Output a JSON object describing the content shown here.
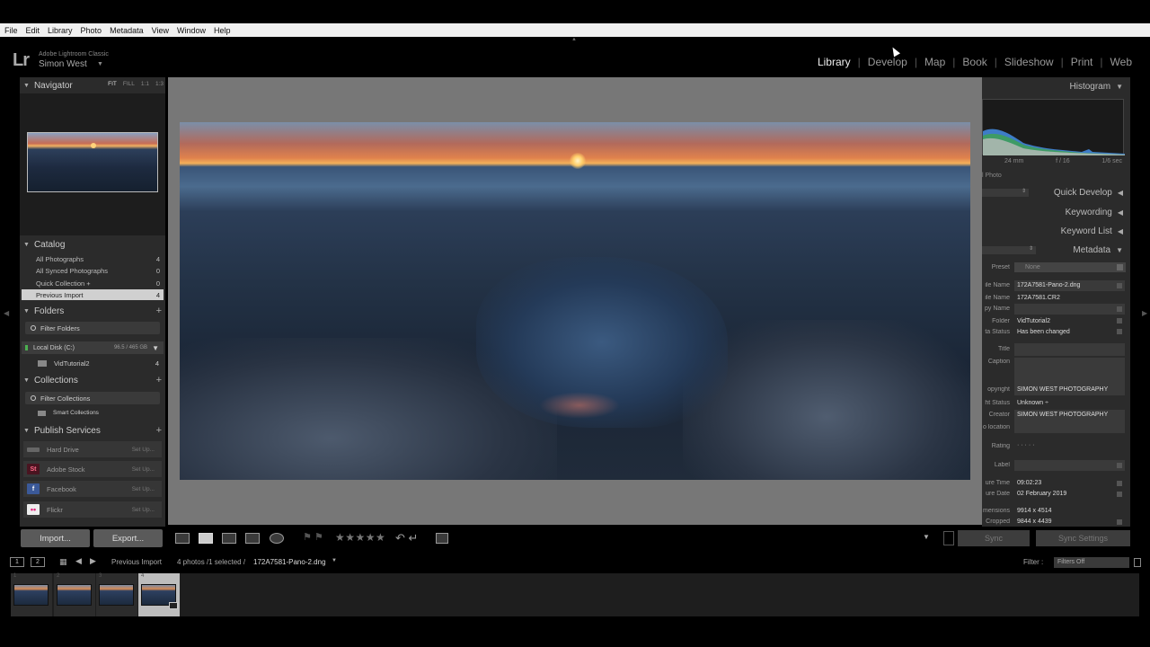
{
  "menu": [
    "File",
    "Edit",
    "Library",
    "Photo",
    "Metadata",
    "View",
    "Window",
    "Help"
  ],
  "identity": {
    "logo": "Lr",
    "app": "Adobe Lightroom Classic",
    "user": "Simon West",
    "caret": "▼"
  },
  "modules": [
    "Library",
    "Develop",
    "Map",
    "Book",
    "Slideshow",
    "Print",
    "Web"
  ],
  "active_module": "Library",
  "navigator": {
    "title": "Navigator",
    "options": [
      "FIT",
      "FILL",
      "1:1",
      "1:3"
    ]
  },
  "catalog": {
    "title": "Catalog",
    "items": [
      {
        "label": "All Photographs",
        "count": "4"
      },
      {
        "label": "All Synced Photographs",
        "count": "0"
      },
      {
        "label": "Quick Collection +",
        "count": "0"
      },
      {
        "label": "Previous Import",
        "count": "4"
      }
    ]
  },
  "folders": {
    "title": "Folders",
    "filter": "Filter Folders",
    "volume": {
      "name": "Local Disk (C:)",
      "size": "96.5 / 465 GB"
    },
    "items": [
      {
        "label": "VidTutorial2",
        "count": "4"
      }
    ]
  },
  "collections": {
    "title": "Collections",
    "filter": "Filter Collections",
    "smart": "Smart Collections"
  },
  "publish": {
    "title": "Publish Services",
    "items": [
      {
        "label": "Hard Drive",
        "setup": "Set Up..."
      },
      {
        "label": "Adobe Stock",
        "setup": "Set Up...",
        "icon": "St"
      },
      {
        "label": "Facebook",
        "setup": "Set Up...",
        "icon": "f"
      },
      {
        "label": "Flickr",
        "setup": "Set Up...",
        "icon": "••"
      }
    ]
  },
  "buttons": {
    "import": "Import...",
    "export": "Export...",
    "sync": "Sync",
    "sync_settings": "Sync Settings"
  },
  "right": {
    "histogram": "Histogram",
    "hist_info": [
      "24 mm",
      "f / 16",
      "1/6 sec"
    ],
    "orig_photo": "l Photo",
    "quick_develop": "Quick Develop",
    "keywording": "Keywording",
    "keyword_list": "Keyword List",
    "metadata": "Metadata",
    "preset_label": "Preset",
    "preset_value": "None",
    "fields": [
      {
        "label": "ile Name",
        "value": "172A7581-Pano-2.dng"
      },
      {
        "label": "ile Name",
        "value": "172A7581.CR2"
      },
      {
        "label": "py Name",
        "value": ""
      },
      {
        "label": "Folder",
        "value": "VidTutorial2"
      },
      {
        "label": "ta Status",
        "value": "Has been changed"
      },
      {
        "label": "Title",
        "value": ""
      },
      {
        "label": "Caption",
        "value": ""
      },
      {
        "label": "opyright",
        "value": "SIMON WEST PHOTOGRAPHY"
      },
      {
        "label": "ht Status",
        "value": "Unknown ÷"
      },
      {
        "label": "Creator",
        "value": "SIMON WEST PHOTOGRAPHY"
      },
      {
        "label": "o location",
        "value": ""
      },
      {
        "label": "Rating",
        "value": "· · · · ·"
      },
      {
        "label": "Label",
        "value": ""
      },
      {
        "label": "ure Time",
        "value": "09:02:23"
      },
      {
        "label": "ure Date",
        "value": "02 February 2019"
      },
      {
        "label": "mensions",
        "value": "9914 x 4514"
      },
      {
        "label": "Cropped",
        "value": "9844 x 4439"
      }
    ]
  },
  "toolbar": {
    "stars": "★★★★★"
  },
  "filmbar": {
    "screen1": "1",
    "screen2": "2",
    "source": "Previous Import",
    "count": "4 photos /1 selected /",
    "filename": "172A7581-Pano-2.dng",
    "filter_label": "Filter :",
    "filter_value": "Filters Off"
  },
  "filmstrip": [
    {
      "idx": "1",
      "selected": false
    },
    {
      "idx": "2",
      "selected": false
    },
    {
      "idx": "3",
      "selected": false
    },
    {
      "idx": "4",
      "selected": true
    }
  ]
}
